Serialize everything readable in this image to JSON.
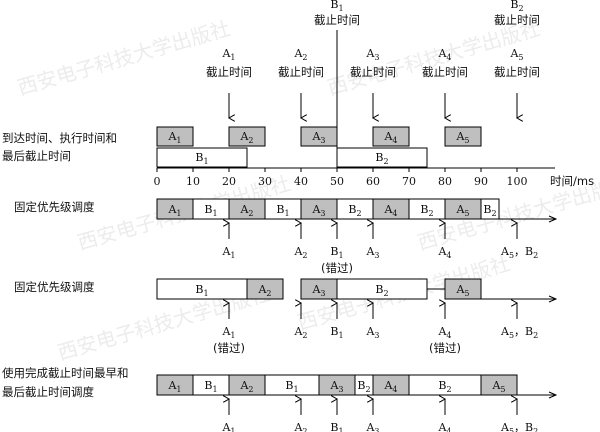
{
  "colors": {
    "task_a_fill": "#bfbfbf",
    "task_b_fill": "#ffffff",
    "stroke": "#000000"
  },
  "watermark": "西安电子科技大学出版社",
  "axis": {
    "unit_label": "时间/ms",
    "ticks": [
      "0",
      "10",
      "20",
      "30",
      "40",
      "50",
      "60",
      "70",
      "80",
      "90",
      "100"
    ],
    "tick_values": [
      0,
      10,
      20,
      30,
      40,
      50,
      60,
      70,
      80,
      90,
      100
    ]
  },
  "deadline_caption": "截止时间",
  "top_arrows": [
    {
      "id": "A1",
      "letter": "A",
      "sub": "1",
      "time": 20
    },
    {
      "id": "A2",
      "letter": "A",
      "sub": "2",
      "time": 40
    },
    {
      "id": "A3",
      "letter": "A",
      "sub": "3",
      "time": 60
    },
    {
      "id": "A4",
      "letter": "A",
      "sub": "4",
      "time": 80
    },
    {
      "id": "A5",
      "letter": "A",
      "sub": "5",
      "time": 100
    }
  ],
  "top_b_deadlines": [
    {
      "id": "B1",
      "letter": "B",
      "sub": "1",
      "time": 50
    },
    {
      "id": "B2",
      "letter": "B",
      "sub": "2",
      "time": 100
    }
  ],
  "arrival_section": {
    "label_line1": "到达时间、执行时间和",
    "label_line2": "最后截止时间",
    "a_tasks": [
      {
        "letter": "A",
        "sub": "1",
        "start": 0,
        "end": 10
      },
      {
        "letter": "A",
        "sub": "2",
        "start": 20,
        "end": 30
      },
      {
        "letter": "A",
        "sub": "3",
        "start": 40,
        "end": 50
      },
      {
        "letter": "A",
        "sub": "4",
        "start": 60,
        "end": 70
      },
      {
        "letter": "A",
        "sub": "5",
        "start": 80,
        "end": 90
      }
    ],
    "b_tasks": [
      {
        "letter": "B",
        "sub": "1",
        "start": 0,
        "end": 25
      },
      {
        "letter": "B",
        "sub": "2",
        "start": 50,
        "end": 75
      }
    ]
  },
  "schedules": [
    {
      "id": "fixed-priority-a",
      "label_line1": "固定优先级调度",
      "label_line2": "",
      "segments": [
        {
          "type": "A",
          "letter": "A",
          "sub": "1",
          "start": 0,
          "end": 10
        },
        {
          "type": "B",
          "letter": "B",
          "sub": "1",
          "start": 10,
          "end": 20
        },
        {
          "type": "A",
          "letter": "A",
          "sub": "2",
          "start": 20,
          "end": 30
        },
        {
          "type": "B",
          "letter": "B",
          "sub": "1",
          "start": 30,
          "end": 40
        },
        {
          "type": "A",
          "letter": "A",
          "sub": "3",
          "start": 40,
          "end": 50
        },
        {
          "type": "B",
          "letter": "B",
          "sub": "2",
          "start": 50,
          "end": 60
        },
        {
          "type": "A",
          "letter": "A",
          "sub": "4",
          "start": 60,
          "end": 70
        },
        {
          "type": "B",
          "letter": "B",
          "sub": "2",
          "start": 70,
          "end": 80
        },
        {
          "type": "A",
          "letter": "A",
          "sub": "5",
          "start": 80,
          "end": 90
        },
        {
          "type": "B",
          "letter": "B",
          "sub": "2",
          "start": 90,
          "end": 95
        }
      ],
      "markers": [
        {
          "time": 20,
          "text": "A",
          "sub": "1"
        },
        {
          "time": 40,
          "text": "A",
          "sub": "2"
        },
        {
          "time": 50,
          "text": "B",
          "sub": "1",
          "note": "(错过)"
        },
        {
          "time": 60,
          "text": "A",
          "sub": "3"
        },
        {
          "time": 80,
          "text": "A",
          "sub": "4"
        },
        {
          "time": 100,
          "text": "A",
          "sub": "5",
          "text2": "B",
          "sub2": "2"
        }
      ]
    },
    {
      "id": "fixed-priority-b",
      "label_line1": "固定优先级调度",
      "label_line2": "",
      "segments": [
        {
          "type": "B",
          "letter": "B",
          "sub": "1",
          "start": 0,
          "end": 25
        },
        {
          "type": "A",
          "letter": "A",
          "sub": "2",
          "start": 25,
          "end": 35
        },
        {
          "type": "A",
          "letter": "A",
          "sub": "3",
          "start": 40,
          "end": 50
        },
        {
          "type": "B",
          "letter": "B",
          "sub": "2",
          "start": 50,
          "end": 75
        },
        {
          "type": "A",
          "letter": "A",
          "sub": "5",
          "start": 80,
          "end": 90
        }
      ],
      "markers": [
        {
          "time": 20,
          "text": "A",
          "sub": "1",
          "note": "(错过)"
        },
        {
          "time": 40,
          "text": "A",
          "sub": "2"
        },
        {
          "time": 50,
          "text": "B",
          "sub": "1"
        },
        {
          "time": 60,
          "text": "A",
          "sub": "3"
        },
        {
          "time": 80,
          "text": "A",
          "sub": "4",
          "note": "(错过)"
        },
        {
          "time": 100,
          "text": "A",
          "sub": "5",
          "text2": "B",
          "sub2": "2"
        }
      ]
    },
    {
      "id": "earliest-deadline",
      "label_line1": "使用完成截止时间最早和",
      "label_line2": "最后截止时间调度",
      "segments": [
        {
          "type": "A",
          "letter": "A",
          "sub": "1",
          "start": 0,
          "end": 10
        },
        {
          "type": "B",
          "letter": "B",
          "sub": "1",
          "start": 10,
          "end": 20
        },
        {
          "type": "A",
          "letter": "A",
          "sub": "2",
          "start": 20,
          "end": 30
        },
        {
          "type": "B",
          "letter": "B",
          "sub": "1",
          "start": 30,
          "end": 45
        },
        {
          "type": "A",
          "letter": "A",
          "sub": "3",
          "start": 45,
          "end": 55
        },
        {
          "type": "B",
          "letter": "B",
          "sub": "2",
          "start": 55,
          "end": 60
        },
        {
          "type": "A",
          "letter": "A",
          "sub": "4",
          "start": 60,
          "end": 70
        },
        {
          "type": "B",
          "letter": "B",
          "sub": "2",
          "start": 70,
          "end": 90
        },
        {
          "type": "A",
          "letter": "A",
          "sub": "5",
          "start": 90,
          "end": 100
        }
      ],
      "markers": [
        {
          "time": 20,
          "text": "A",
          "sub": "1"
        },
        {
          "time": 40,
          "text": "A",
          "sub": "2"
        },
        {
          "time": 50,
          "text": "B",
          "sub": "1"
        },
        {
          "time": 60,
          "text": "A",
          "sub": "3"
        },
        {
          "time": 80,
          "text": "A",
          "sub": "4"
        },
        {
          "time": 100,
          "text": "A",
          "sub": "5",
          "text2": "B",
          "sub2": "2"
        }
      ]
    }
  ]
}
